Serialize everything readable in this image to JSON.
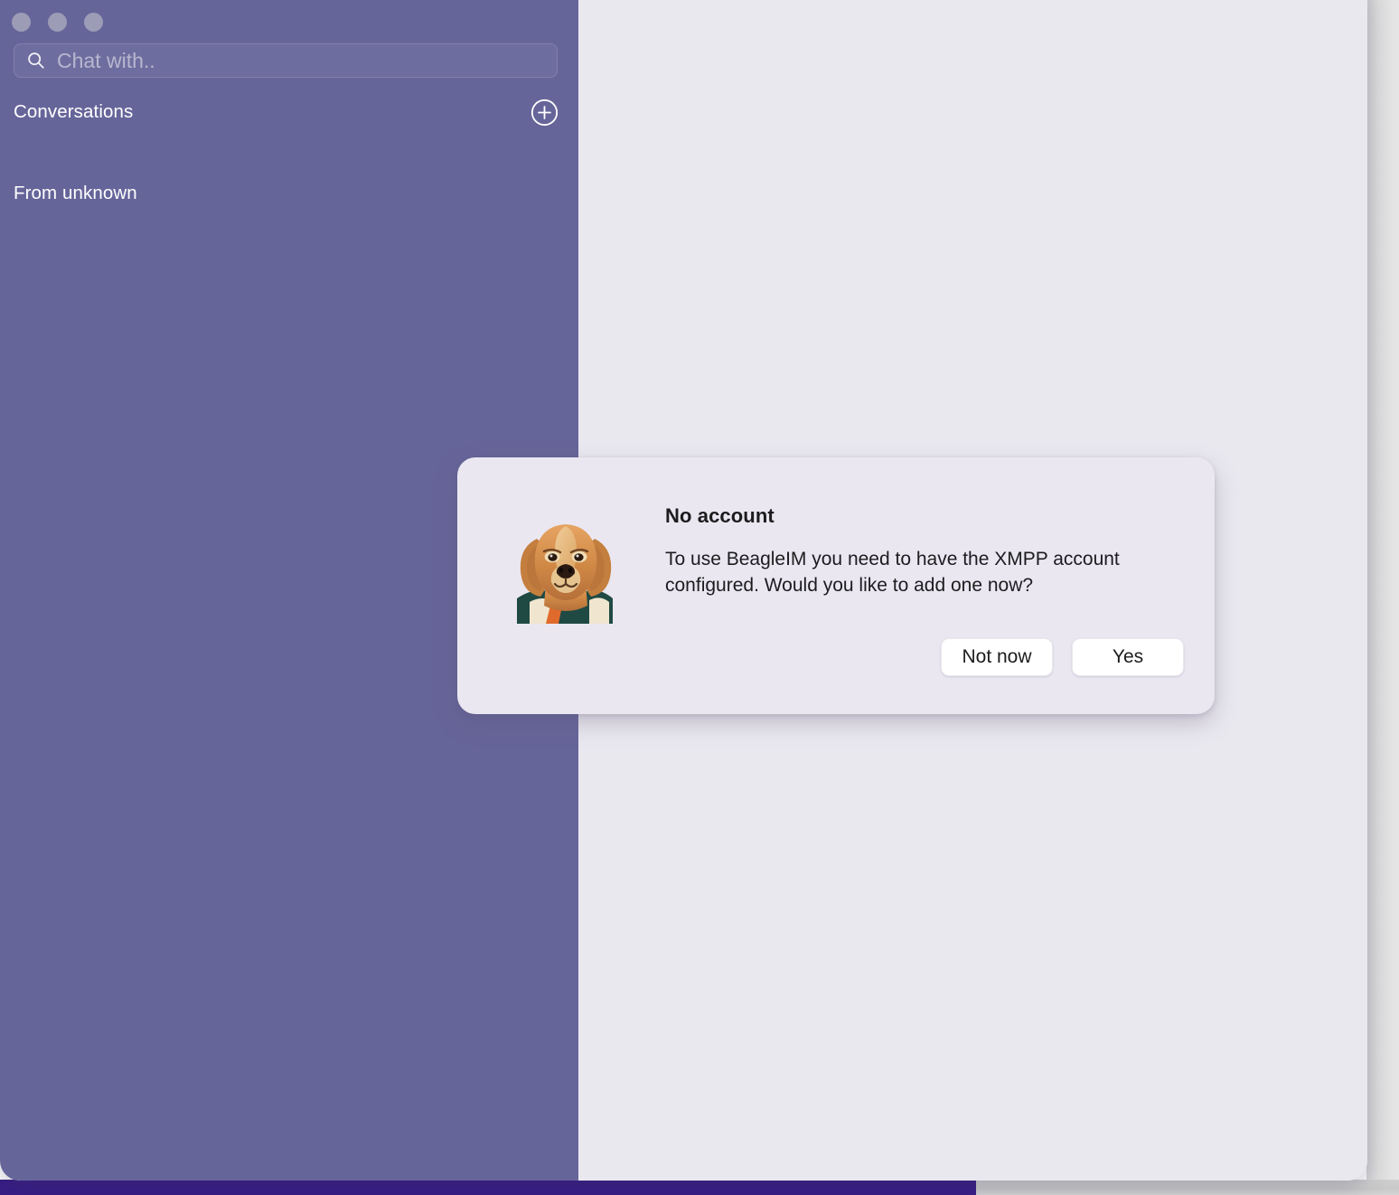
{
  "window": {
    "traffic_lights": [
      "close-button",
      "minimize-button",
      "zoom-button"
    ]
  },
  "sidebar": {
    "search": {
      "placeholder": "Chat with..",
      "value": "",
      "icon": "search-icon"
    },
    "conversations": {
      "title": "Conversations",
      "add_icon": "plus-circle-icon"
    },
    "sections": [
      {
        "title": "From unknown",
        "items": []
      }
    ],
    "background_color": "#66659a"
  },
  "main": {
    "background_color": "#eae8ef"
  },
  "dialog": {
    "icon": "beagle-dog-icon",
    "title": "No account",
    "message": "To use BeagleIM you need to have the XMPP account configured. Would you like to add one now?",
    "buttons": [
      {
        "label": "Not now",
        "name": "not-now-button"
      },
      {
        "label": "Yes",
        "name": "yes-button"
      }
    ],
    "background_color": "#eae7f1"
  },
  "desktop": {
    "accent_color": "#371b85"
  }
}
